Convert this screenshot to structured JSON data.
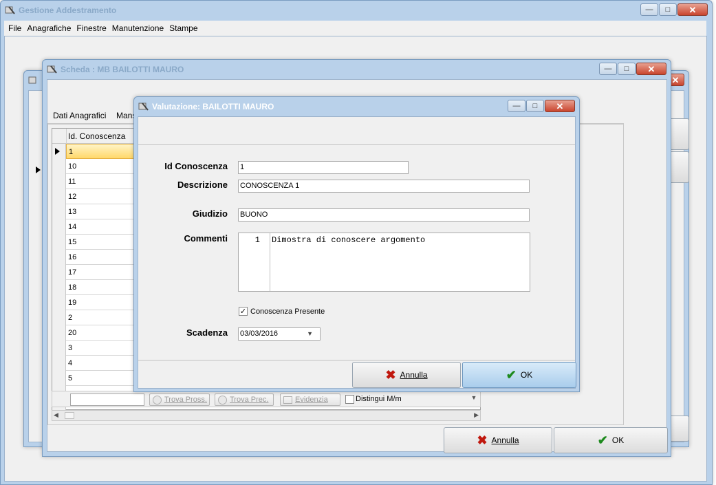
{
  "main_window": {
    "title": "Gestione Addestramento",
    "menu": [
      "File",
      "Anagrafiche",
      "Finestre",
      "Manutenzione",
      "Stampe"
    ]
  },
  "scheda_window": {
    "title": "Scheda : MB BAILOTTI MAURO",
    "tabs": [
      "Dati Anagrafici",
      "Mans"
    ],
    "grid": {
      "column_header": "Id. Conoscenza",
      "rows": [
        "1",
        "10",
        "11",
        "12",
        "13",
        "14",
        "15",
        "16",
        "17",
        "18",
        "19",
        "2",
        "20",
        "3",
        "4",
        "5"
      ]
    },
    "search": {
      "find_next": "Trova Pross.",
      "find_prev": "Trova Prec.",
      "highlight": "Evidenzia",
      "case_sensitive": "Distingui M/m"
    },
    "cancel_label": "Annulla",
    "ok_label": "OK"
  },
  "dialog": {
    "title": "Valutazione: BAILOTTI MAURO",
    "fields": {
      "id_label": "Id Conoscenza",
      "id_value": "1",
      "descr_label": "Descrizione",
      "descr_value": "CONOSCENZA 1",
      "giudizio_label": "Giudizio",
      "giudizio_value": "BUONO",
      "commenti_label": "Commenti",
      "commenti_line_no": "1",
      "commenti_value": "Dimostra di conoscere argomento",
      "presente_label": "Conoscenza Presente",
      "presente_checked": true,
      "scadenza_label": "Scadenza",
      "scadenza_value": "03/03/2016"
    },
    "cancel_label": "Annulla",
    "ok_label": "OK"
  },
  "icons": {
    "app": "app-logo-icon",
    "cancel": "red-x-icon",
    "ok": "green-check-icon"
  }
}
